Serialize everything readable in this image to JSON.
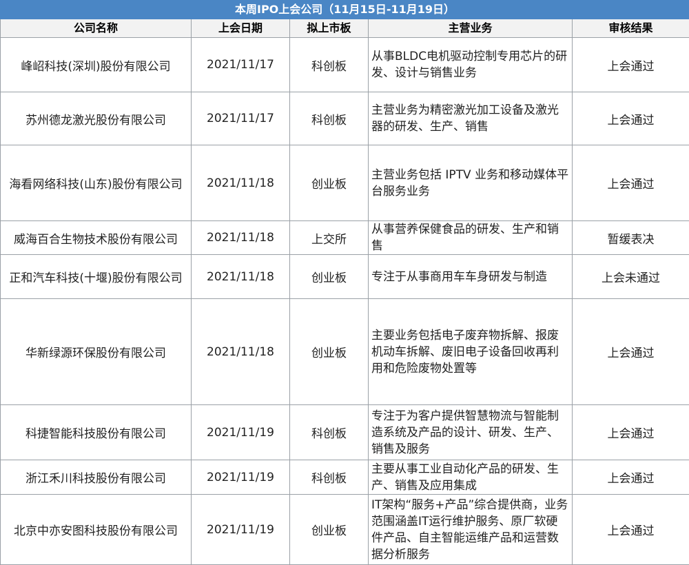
{
  "title": "本周IPO上会公司（11月15日-11月19日）",
  "columns": [
    "公司名称",
    "上会日期",
    "拟上市板",
    "主营业务",
    "审核结果"
  ],
  "rows": [
    {
      "company": "峰岹科技(深圳)股份有限公司",
      "date": "2021/11/17",
      "board": "科创板",
      "business": "从事BLDC电机驱动控制专用芯片的研发、设计与销售业务",
      "result": "上会通过"
    },
    {
      "company": "苏州德龙激光股份有限公司",
      "date": "2021/11/17",
      "board": "科创板",
      "business": "主营业务为精密激光加工设备及激光器的研发、生产、销售",
      "result": "上会通过"
    },
    {
      "company": "海看网络科技(山东)股份有限公司",
      "date": "2021/11/18",
      "board": "创业板",
      "business": "主营业务包括 IPTV 业务和移动媒体平台服务业务",
      "result": "上会通过"
    },
    {
      "company": "威海百合生物技术股份有限公司",
      "date": "2021/11/18",
      "board": "上交所",
      "business": "从事营养保健食品的研发、生产和销售",
      "result": "暂缓表决"
    },
    {
      "company": "正和汽车科技(十堰)股份有限公司",
      "date": "2021/11/18",
      "board": "创业板",
      "business": "专注于从事商用车车身研发与制造",
      "result": "上会未通过"
    },
    {
      "company": "华新绿源环保股份有限公司",
      "date": "2021/11/18",
      "board": "创业板",
      "business": "主要业务包括电子废弃物拆解、报废机动车拆解、废旧电子设备回收再利用和危险废物处置等",
      "result": "上会通过"
    },
    {
      "company": "科捷智能科技股份有限公司",
      "date": "2021/11/19",
      "board": "科创板",
      "business": "专注于为客户提供智慧物流与智能制造系统及产品的设计、研发、生产、销售及服务",
      "result": "上会通过"
    },
    {
      "company": "浙江禾川科技股份有限公司",
      "date": "2021/11/19",
      "board": "科创板",
      "business": "主要从事工业自动化产品的研发、生产、销售及应用集成",
      "result": "上会通过"
    },
    {
      "company": "北京中亦安图科技股份有限公司",
      "date": "2021/11/19",
      "board": "创业板",
      "business": "IT架构“服务+产品”综合提供商，业务范围涵盖IT运行维护服务、原厂软硬件产品、自主智能运维产品和运营数据分析服务",
      "result": "上会通过"
    }
  ]
}
